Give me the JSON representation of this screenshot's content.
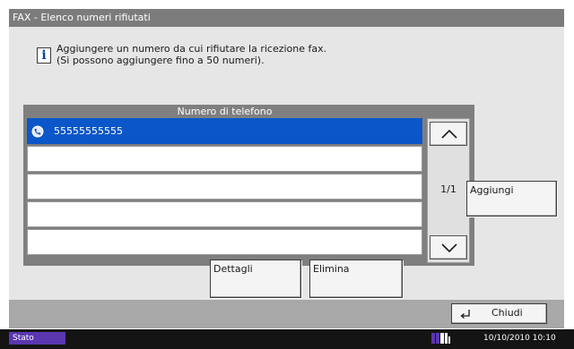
{
  "window": {
    "title": "FAX - Elenco numeri rifiutati"
  },
  "info": {
    "line1": "Aggiungere un numero da cui rifiutare la ricezione fax.",
    "line2": "(Si possono aggiungere fino a 50 numeri)."
  },
  "list": {
    "header": "Numero di telefono",
    "rows": [
      {
        "number": "55555555555",
        "selected": true
      },
      {
        "number": "",
        "selected": false
      },
      {
        "number": "",
        "selected": false
      },
      {
        "number": "",
        "selected": false
      },
      {
        "number": "",
        "selected": false
      }
    ],
    "page_indicator": "1/1"
  },
  "buttons": {
    "add": "Aggiungi",
    "details": "Dettagli",
    "delete": "Elimina",
    "close": "Chiudi"
  },
  "status": {
    "label": "Stato",
    "datetime": "10/10/2010  10:10"
  },
  "colors": {
    "title_bar": "#7c7c7c",
    "selected_row": "#0b56c8",
    "status_label": "#5a36b0"
  }
}
